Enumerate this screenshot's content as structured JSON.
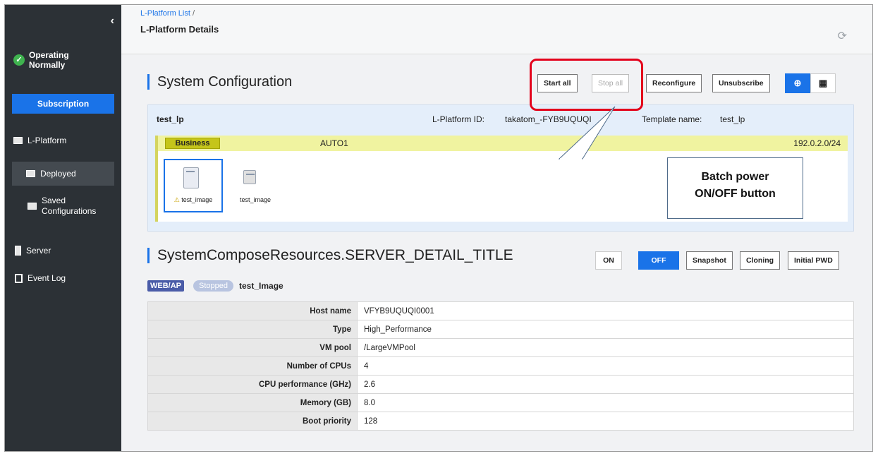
{
  "sidebar": {
    "collapse_glyph": "‹",
    "status": "Operating Normally",
    "subscription_label": "Subscription",
    "items": [
      {
        "label": "L-Platform",
        "icon": "lplatform-icon"
      },
      {
        "label": "Deployed",
        "icon": "deployed-icon"
      },
      {
        "label": "Saved Configurations",
        "icon": "saved-icon"
      },
      {
        "label": "Server",
        "icon": "server-icon"
      },
      {
        "label": "Event Log",
        "icon": "event-log-icon"
      }
    ]
  },
  "header": {
    "breadcrumb": "L-Platform List",
    "breadcrumb_sep": "/",
    "title": "L-Platform Details",
    "refresh_glyph": "⟳"
  },
  "system_config": {
    "title": "System Configuration",
    "buttons": {
      "start_all": "Start all",
      "stop_all": "Stop all",
      "reconfigure": "Reconfigure",
      "unsubscribe": "Unsubscribe",
      "diagram_view": "⊕",
      "table_view": "▦"
    },
    "lplatform_name": "test_lp",
    "lplatform_id_label": "L-Platform ID:",
    "lplatform_id": "takatom_-FYB9UQUQI",
    "template_label": "Template name:",
    "template_name": "test_lp",
    "segment": {
      "badge": "Business",
      "name": "AUTO1",
      "network": "192.0.2.0/24"
    },
    "servers": [
      {
        "label": "test_image",
        "marker": "⚠",
        "selected": true
      },
      {
        "label": "test_image",
        "marker": "",
        "selected": false
      }
    ]
  },
  "callout": {
    "line1": "Batch power",
    "line2": "ON/OFF button"
  },
  "server_detail": {
    "title": "SystemComposeResources.SERVER_DETAIL_TITLE",
    "buttons": {
      "on": "ON",
      "off": "OFF",
      "snapshot": "Snapshot",
      "cloning": "Cloning",
      "initial_pwd": "Initial PWD"
    },
    "badge_role": "WEB/AP",
    "badge_status": "Stopped",
    "server_name": "test_Image",
    "rows": [
      {
        "k": "Host name",
        "v": "VFYB9UQUQI0001"
      },
      {
        "k": "Type",
        "v": "High_Performance"
      },
      {
        "k": "VM pool",
        "v": "/LargeVMPool"
      },
      {
        "k": "Number of CPUs",
        "v": "4"
      },
      {
        "k": "CPU performance (GHz)",
        "v": "2.6"
      },
      {
        "k": "Memory (GB)",
        "v": "8.0"
      },
      {
        "k": "Boot priority",
        "v": "128"
      }
    ]
  },
  "colors": {
    "sidebar_bg": "#2c3136",
    "accent": "#1a73e8",
    "highlight": "#e3001b",
    "segment_bar": "#f0f3a0"
  }
}
